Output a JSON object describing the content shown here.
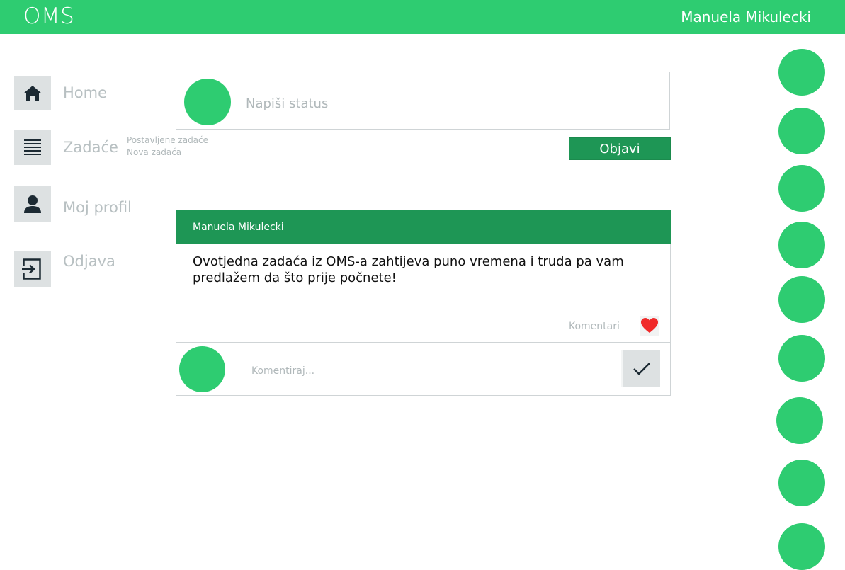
{
  "header": {
    "logo": "OMS",
    "username": "Manuela Mikulecki",
    "accent": "#2ecc71"
  },
  "sidebar": {
    "items": [
      {
        "label": "Home",
        "icon": "home-icon"
      },
      {
        "label": "Zadaće",
        "icon": "list-icon"
      },
      {
        "label": "Moj profil",
        "icon": "user-icon"
      },
      {
        "label": "Odjava",
        "icon": "logout-icon"
      }
    ],
    "submenu": [
      "Postavljene zadaće",
      "Nova zadaća"
    ]
  },
  "composer": {
    "placeholder": "Napiši status",
    "button_label": "Objavi"
  },
  "post": {
    "author": "Manuela Mikulecki",
    "text": "Ovotjedna zadaća iz OMS-a zahtijeva puno vremena i truda pa vam predlažem da što prije počnete!",
    "comments_label": "Komentari",
    "comment_placeholder": "Komentiraj...",
    "header_color": "#1e9655",
    "like_color": "#f02a2a"
  },
  "friends": {
    "count_visible": 9
  }
}
